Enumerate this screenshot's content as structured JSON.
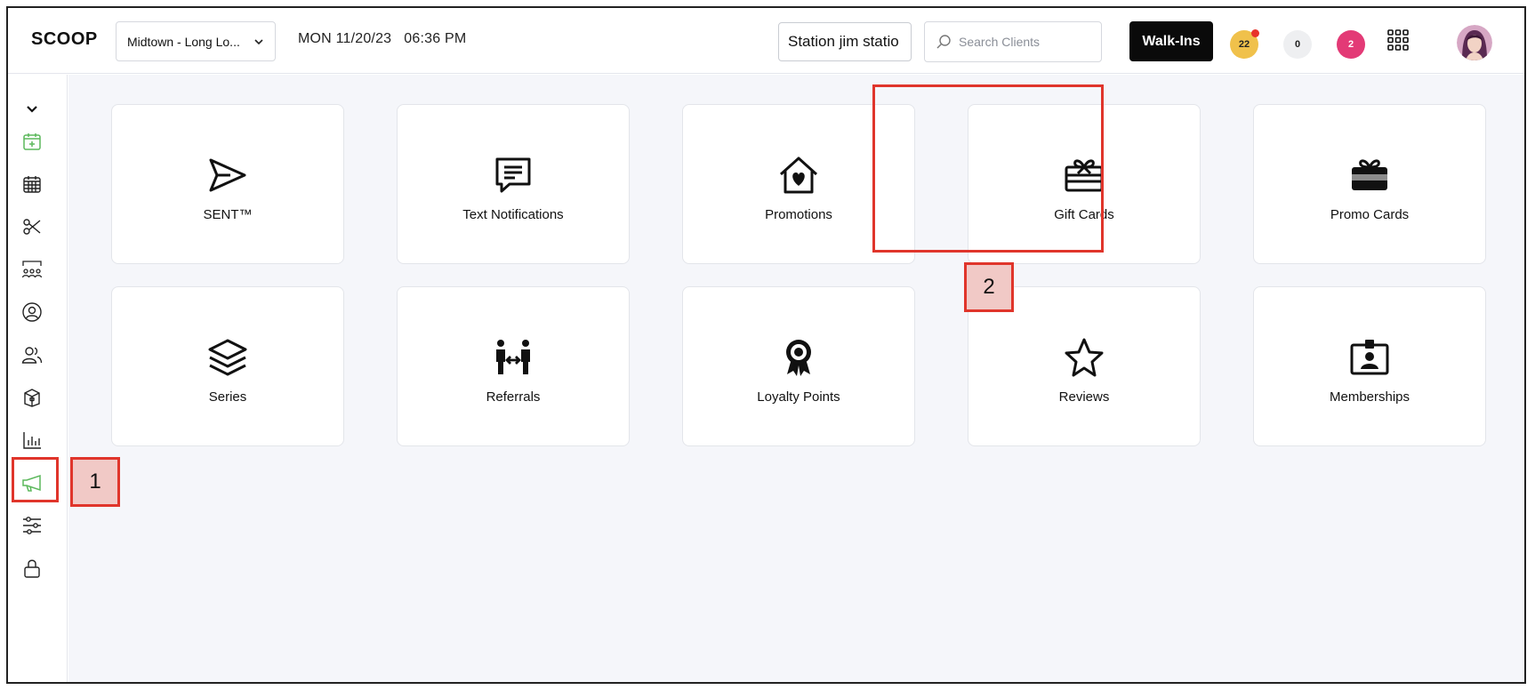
{
  "app": {
    "title": "SCOOP"
  },
  "header": {
    "location": "Midtown - Long Lo...",
    "date": "MON 11/20/23",
    "time": "06:36 PM",
    "station": "Station jim statio",
    "search_placeholder": "Search Clients",
    "walkins_label": "Walk-Ins",
    "badges": [
      {
        "value": "22",
        "color": "#f0c14b",
        "has_alert_dot": true
      },
      {
        "value": "0",
        "color": "#eeeff1"
      },
      {
        "value": "2",
        "color": "#e33a76"
      }
    ]
  },
  "sidebar": {
    "items": [
      {
        "icon": "chevron-down-icon"
      },
      {
        "icon": "calendar-plus-icon",
        "active_color": "#5cb85c"
      },
      {
        "icon": "calendar-grid-icon"
      },
      {
        "icon": "scissors-icon"
      },
      {
        "icon": "team-icon"
      },
      {
        "icon": "user-circle-icon"
      },
      {
        "icon": "users-icon"
      },
      {
        "icon": "box-icon"
      },
      {
        "icon": "bar-chart-icon"
      },
      {
        "icon": "megaphone-icon",
        "active": true,
        "active_color": "#5cb85c"
      },
      {
        "icon": "sliders-icon"
      },
      {
        "icon": "lock-icon"
      }
    ]
  },
  "marketing": {
    "cards": [
      {
        "label": "SENT™",
        "icon": "send-icon"
      },
      {
        "label": "Text Notifications",
        "icon": "message-icon"
      },
      {
        "label": "Promotions",
        "icon": "house-heart-icon"
      },
      {
        "label": "Gift Cards",
        "icon": "gift-card-icon"
      },
      {
        "label": "Promo Cards",
        "icon": "promo-card-icon"
      },
      {
        "label": "Series",
        "icon": "layers-icon"
      },
      {
        "label": "Referrals",
        "icon": "referrals-icon"
      },
      {
        "label": "Loyalty Points",
        "icon": "award-icon"
      },
      {
        "label": "Reviews",
        "icon": "star-icon"
      },
      {
        "label": "Memberships",
        "icon": "id-badge-icon"
      }
    ]
  },
  "annotations": {
    "markers": [
      "1",
      "2"
    ],
    "color": "#e0352b"
  }
}
